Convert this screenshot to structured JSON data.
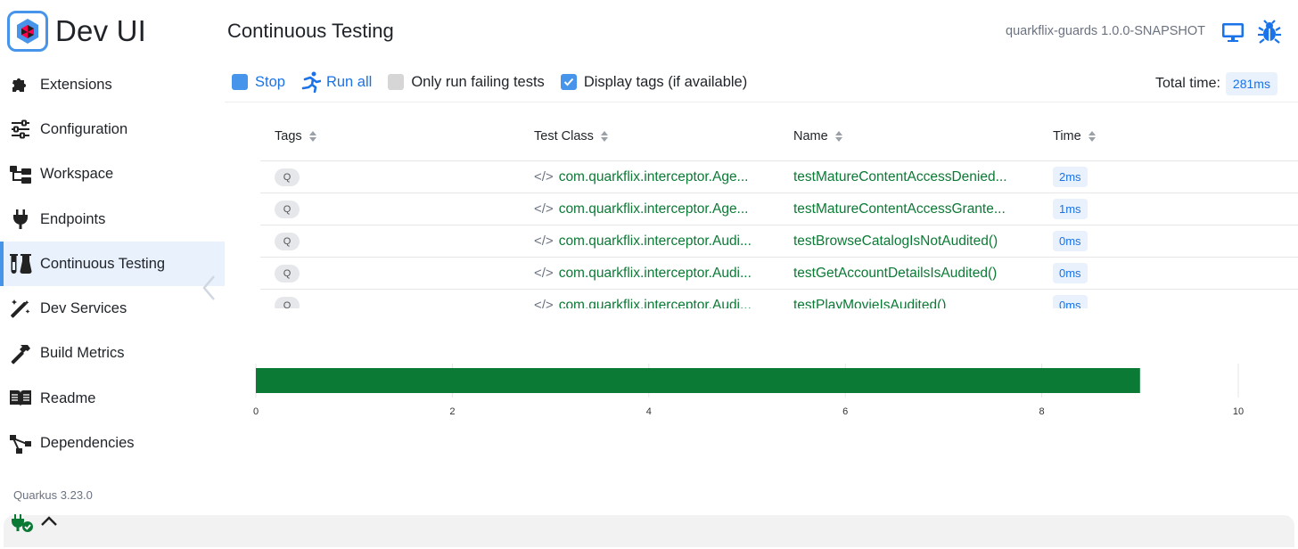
{
  "app": {
    "brand_title": "Dev UI",
    "quarkus_version": "Quarkus 3.23.0"
  },
  "sidebar": {
    "items": [
      {
        "label": "Extensions",
        "icon": "puzzle-icon",
        "active": false
      },
      {
        "label": "Configuration",
        "icon": "sliders-icon",
        "active": false
      },
      {
        "label": "Workspace",
        "icon": "folder-tree-icon",
        "active": false
      },
      {
        "label": "Endpoints",
        "icon": "plug-icon",
        "active": false
      },
      {
        "label": "Continuous Testing",
        "icon": "flask-icon",
        "active": true
      },
      {
        "label": "Dev Services",
        "icon": "magic-wand-icon",
        "active": false
      },
      {
        "label": "Build Metrics",
        "icon": "hammer-icon",
        "active": false
      },
      {
        "label": "Readme",
        "icon": "book-icon",
        "active": false
      },
      {
        "label": "Dependencies",
        "icon": "diagram-icon",
        "active": false
      }
    ]
  },
  "header": {
    "title": "Continuous Testing",
    "app_version": "quarkflix-guards 1.0.0-SNAPSHOT"
  },
  "toolbar": {
    "stop_label": "Stop",
    "run_all_label": "Run all",
    "only_failing_label": "Only run failing tests",
    "only_failing_checked": false,
    "display_tags_label": "Display tags (if available)",
    "display_tags_checked": true,
    "total_time_label": "Total time:",
    "total_time_value": "281ms"
  },
  "table": {
    "columns": [
      "Tags",
      "Test Class",
      "Name",
      "Time"
    ],
    "rows": [
      {
        "tag": "Q",
        "class": "com.quarkflix.interceptor.Age...",
        "name": "testMatureContentAccessDenied...",
        "time": "2ms"
      },
      {
        "tag": "Q",
        "class": "com.quarkflix.interceptor.Age...",
        "name": "testMatureContentAccessGrante...",
        "time": "1ms"
      },
      {
        "tag": "Q",
        "class": "com.quarkflix.interceptor.Audi...",
        "name": "testBrowseCatalogIsNotAudited()",
        "time": "0ms"
      },
      {
        "tag": "Q",
        "class": "com.quarkflix.interceptor.Audi...",
        "name": "testGetAccountDetailsIsAudited()",
        "time": "0ms"
      },
      {
        "tag": "Q",
        "class": "com.quarkflix.interceptor.Audi...",
        "name": "testPlayMovieIsAudited()",
        "time": "0ms"
      }
    ]
  },
  "chart_data": {
    "type": "bar",
    "orientation": "horizontal",
    "values": [
      9
    ],
    "xlim": [
      0,
      10
    ],
    "ticks": [
      "0",
      "2",
      "4",
      "6",
      "8",
      "10"
    ],
    "color": "#0b7a35",
    "grid": true
  },
  "colors": {
    "accent": "#4695eb",
    "link_blue": "#1a73e8",
    "pass_green": "#0b7a35",
    "active_bg": "#e8f1fc"
  }
}
